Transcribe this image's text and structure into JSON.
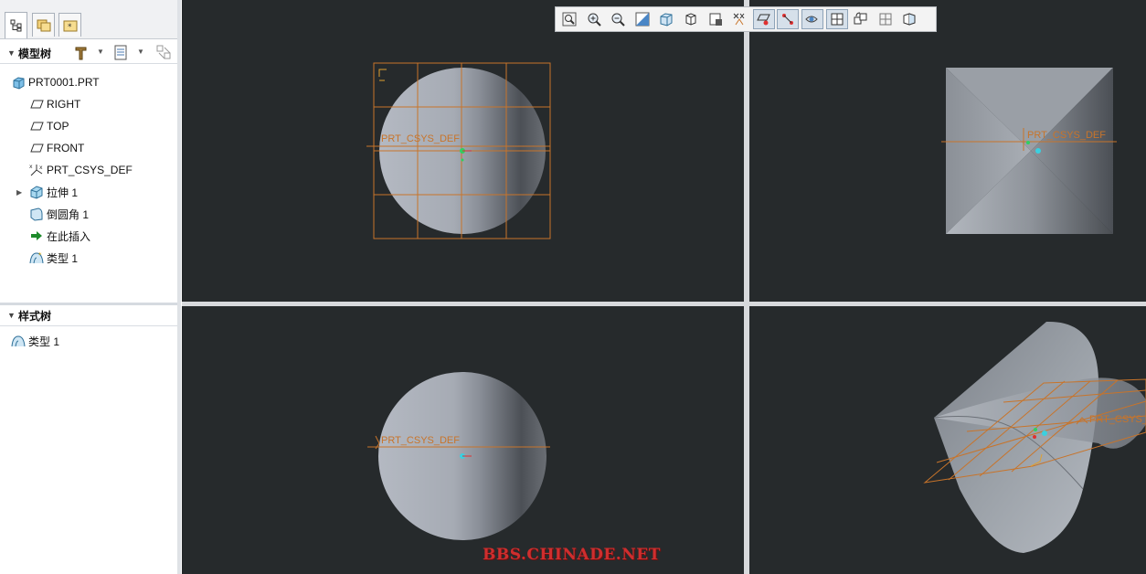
{
  "model_tree": {
    "title": "模型树",
    "items": [
      {
        "label": "PRT0001.PRT",
        "icon": "part-icon"
      },
      {
        "label": "RIGHT",
        "icon": "datum-plane-icon"
      },
      {
        "label": "TOP",
        "icon": "datum-plane-icon"
      },
      {
        "label": "FRONT",
        "icon": "datum-plane-icon"
      },
      {
        "label": "PRT_CSYS_DEF",
        "icon": "coordinate-system-icon"
      },
      {
        "label": "拉伸 1",
        "icon": "extrude-icon",
        "expandable": true
      },
      {
        "label": "倒圆角 1",
        "icon": "round-icon"
      },
      {
        "label": "在此插入",
        "icon": "insert-here-arrow-icon"
      },
      {
        "label": "类型 1",
        "icon": "style-feature-icon"
      }
    ]
  },
  "style_tree": {
    "title": "样式树",
    "items": [
      {
        "label": "类型 1",
        "icon": "style-feature-icon"
      }
    ]
  },
  "viewports": {
    "top_left": {
      "csys_label": "PRT_CSYS_DEF"
    },
    "top_right": {
      "csys_label": "PRT_CSYS_DEF"
    },
    "bottom_left": {
      "csys_label": "PRT_CSYS_DEF"
    },
    "bottom_right": {
      "csys_label": "PRT_CSYS_"
    }
  },
  "toolbar": {
    "buttons": [
      "refit-icon",
      "zoom-in-icon",
      "zoom-out-icon",
      "reorient-icon",
      "saved-views-icon",
      "display-style-icon",
      "view-manager-icon",
      "annotation-display-icon",
      "plane-display-icon",
      "axis-display-icon",
      "point-display-icon",
      "csys-display-icon",
      "spin-center-icon",
      "named-view-icon",
      "quad-view-icon"
    ]
  },
  "watermark": "BBS.CHINADE.NET",
  "colors": {
    "viewport_bg": "#262a2c",
    "datum_orange": "#c8742a",
    "watermark_red": "#cf2e2e"
  }
}
